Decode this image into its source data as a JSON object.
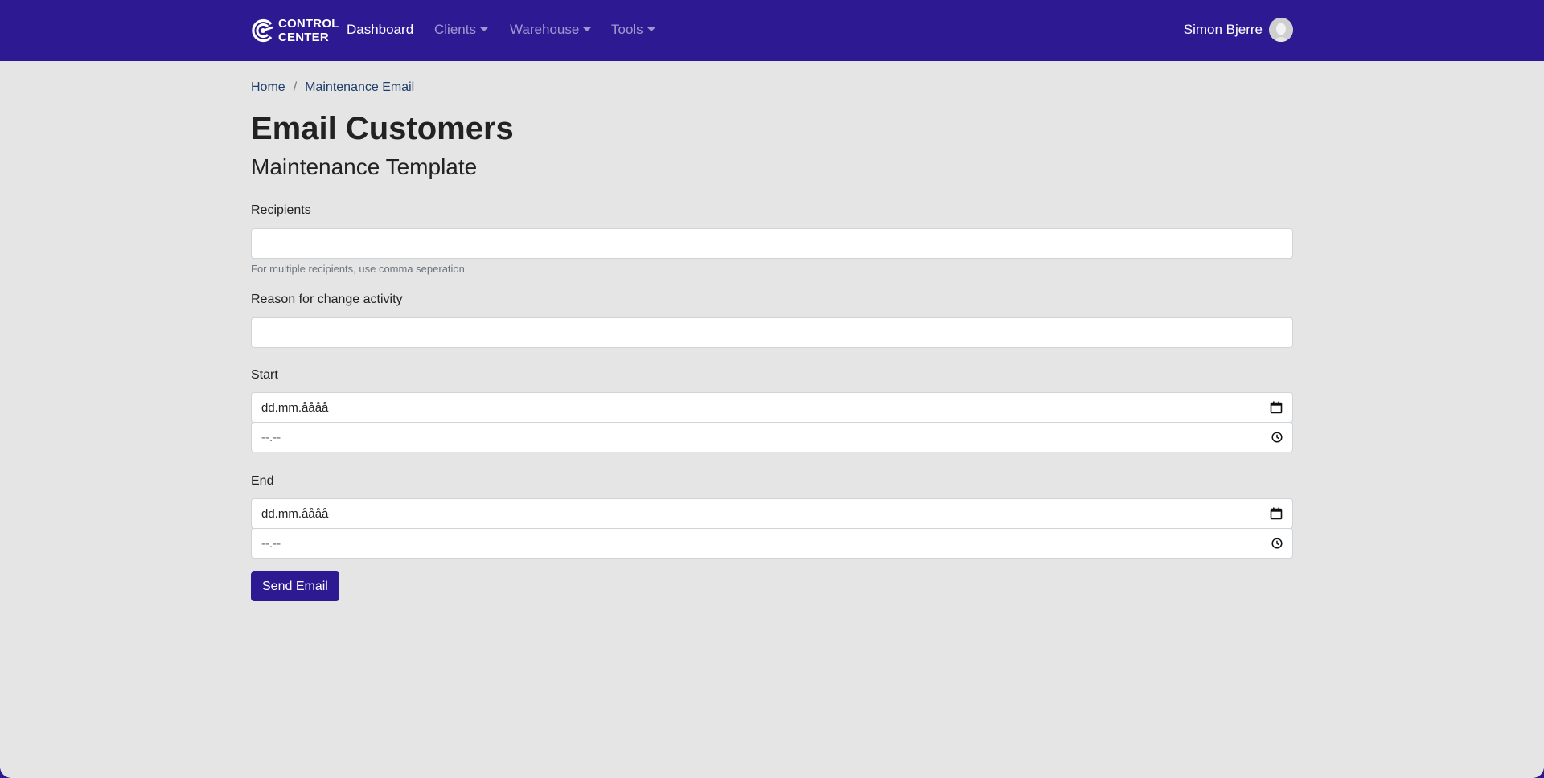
{
  "brand": {
    "line1": "CONTROL",
    "line2": "CENTER",
    "logo_icon": "target-c-icon"
  },
  "nav": {
    "items": [
      {
        "label": "Dashboard",
        "active": true,
        "dropdown": false
      },
      {
        "label": "Clients",
        "active": false,
        "dropdown": true
      },
      {
        "label": "Warehouse",
        "active": false,
        "dropdown": true
      },
      {
        "label": "Tools",
        "active": false,
        "dropdown": true
      }
    ],
    "user_name": "Simon Bjerre",
    "user_avatar_icon": "avatar-icon"
  },
  "breadcrumb": {
    "home": "Home",
    "separator": "/",
    "current": "Maintenance Email"
  },
  "page": {
    "title": "Email Customers",
    "subtitle": "Maintenance Template"
  },
  "form": {
    "recipients_label": "Recipients",
    "recipients_value": "",
    "recipients_help": "For multiple recipients, use comma seperation",
    "reason_label": "Reason for change activity",
    "reason_value": "",
    "start_label": "Start",
    "start_date_placeholder": "dd.mm.åååå",
    "start_time_placeholder": "--.--",
    "end_label": "End",
    "end_date_placeholder": "dd.mm.åååå",
    "end_time_placeholder": "--.--",
    "submit_label": "Send Email"
  },
  "colors": {
    "navbar": "#2d1a93",
    "background": "#e5e5e6",
    "button": "#2d1a93",
    "link": "#1f3f6b"
  }
}
